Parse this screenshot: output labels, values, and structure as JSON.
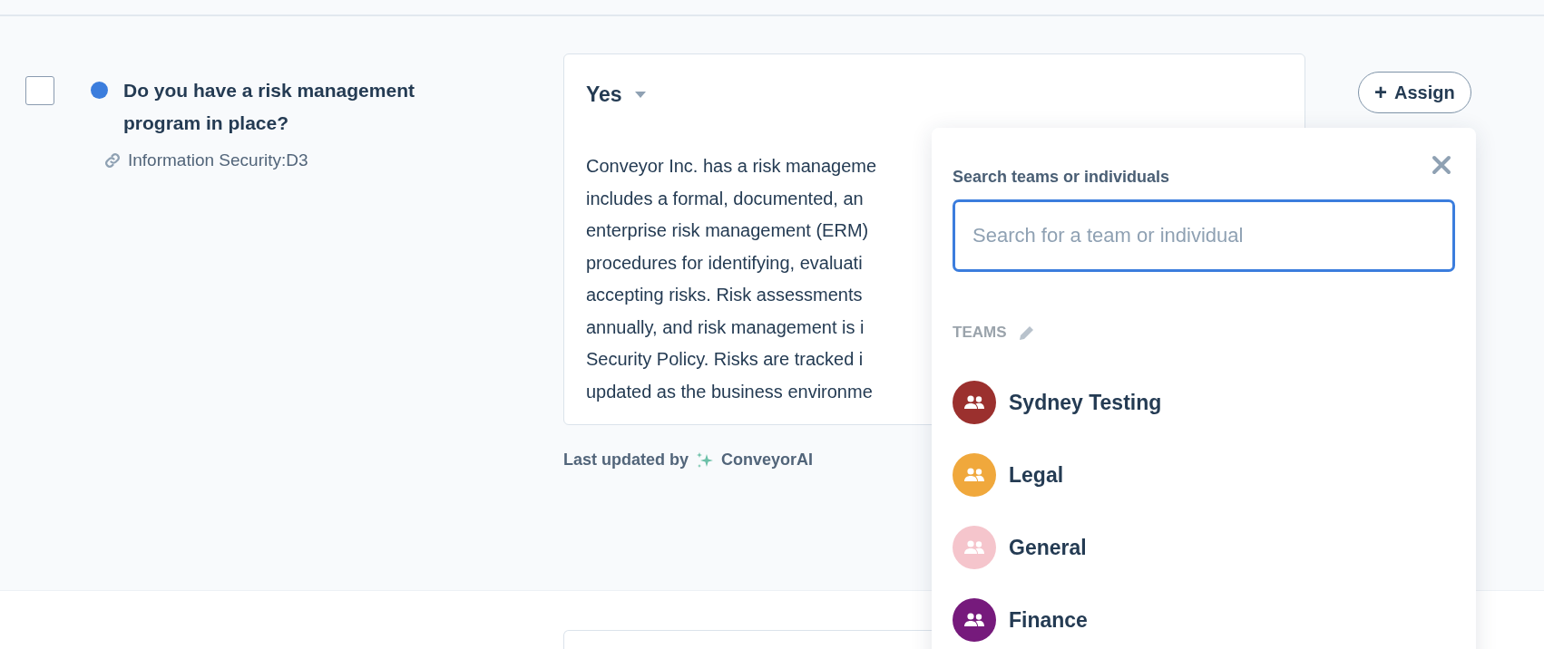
{
  "question": {
    "checked": false,
    "text": "Do you have a risk management program in place?",
    "reference": "Information Security:D3"
  },
  "answer": {
    "value": "Yes",
    "lines": [
      "Conveyor Inc. has a risk manageme",
      "includes a formal, documented, an",
      "enterprise risk management (ERM)",
      "procedures for identifying, evaluati",
      "accepting risks. Risk assessments",
      "annually, and risk management is i",
      "Security Policy. Risks are tracked i",
      "updated as the business environme"
    ],
    "updated_label": "Last updated by",
    "updated_by": "ConveyorAI"
  },
  "assign_button": {
    "icon": "+",
    "label": "Assign"
  },
  "assign_popup": {
    "label": "Search teams or individuals",
    "placeholder": "Search for a team or individual",
    "section": "TEAMS",
    "teams": [
      {
        "name": "Sydney Testing",
        "color": "#9b302e"
      },
      {
        "name": "Legal",
        "color": "#f0a83c"
      },
      {
        "name": "General",
        "color": "#f5c5cc"
      },
      {
        "name": "Finance",
        "color": "#761a7c"
      }
    ]
  }
}
